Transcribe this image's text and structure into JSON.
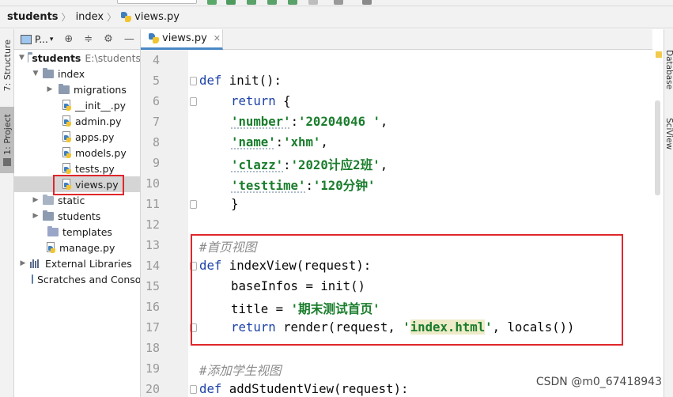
{
  "toolbar": {
    "run_config": "students"
  },
  "breadcrumb": {
    "items": [
      "students",
      "index",
      "views.py"
    ]
  },
  "left_strip": {
    "structure_label": "7: Structure",
    "project_label": "1: Project"
  },
  "project_panel": {
    "title": "P...",
    "tree": {
      "root_name": "students",
      "root_path": "E:\\students",
      "index": "index",
      "migrations": "migrations",
      "init": "__init__.py",
      "admin": "admin.py",
      "apps": "apps.py",
      "models": "models.py",
      "tests": "tests.py",
      "views": "views.py",
      "static": "static",
      "students_pkg": "students",
      "templates": "templates",
      "manage": "manage.py",
      "external": "External Libraries",
      "scratches": "Scratches and Consoles"
    }
  },
  "editor": {
    "tab_label": "views.py",
    "line_numbers": [
      "4",
      "5",
      "6",
      "7",
      "8",
      "9",
      "10",
      "11",
      "12",
      "13",
      "14",
      "15",
      "16",
      "17",
      "18",
      "19",
      "20"
    ],
    "code": {
      "l5_def": "def",
      "l5_rest": " init():",
      "l6_kw": "return",
      "l6_rest": " {",
      "l7_key": "'number'",
      "l7_colon": ":",
      "l7_val": "'20204046 '",
      "l7_end": ",",
      "l8_key": "'name'",
      "l8_colon": ":",
      "l8_val": "'xhm'",
      "l8_end": ",",
      "l9_key": "'clazz'",
      "l9_colon": ":",
      "l9_val": "'2020计应2班'",
      "l9_end": ",",
      "l10_key": "'testtime'",
      "l10_colon": ":",
      "l10_val": "'120分钟'",
      "l11": "}",
      "l13": "#首页视图",
      "l14_def": "def",
      "l14_rest": " indexView(request):",
      "l15": "baseInfos = init()",
      "l16_a": "title = ",
      "l16_str": "'期末测试首页'",
      "l17_kw": "return",
      "l17_a": " render(request, ",
      "l17_q1": "'",
      "l17_hl": "index.html",
      "l17_q2": "'",
      "l17_b": ", locals())",
      "l19": "#添加学生视图",
      "l20_def": "def",
      "l20_rest": " addStudentView(request):"
    }
  },
  "right_strip": {
    "database_label": "Database",
    "sciview_label": "SciView"
  },
  "watermark": "CSDN @m0_67418943",
  "colors": {
    "highlight_box": "#e0272b",
    "keyword": "#1c41a8",
    "string": "#1a7d2c",
    "comment": "#8c8c8c"
  }
}
